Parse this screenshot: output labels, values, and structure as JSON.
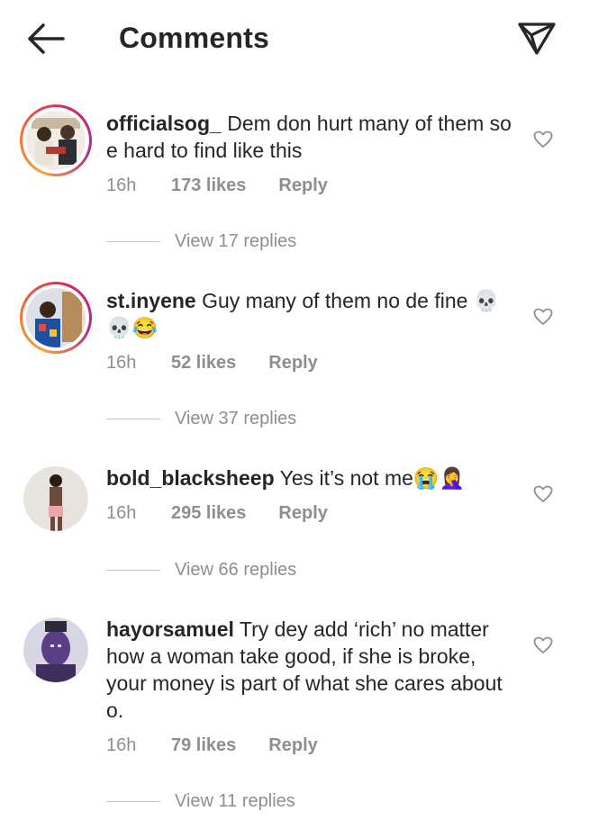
{
  "header": {
    "title": "Comments"
  },
  "comments": [
    {
      "username": "officialsog_",
      "text": " Dem don hurt many of them so e hard to find like this",
      "time": "16h",
      "likes": "173 likes",
      "reply": "Reply",
      "view_replies": "View 17 replies"
    },
    {
      "username": "st.inyene",
      "text": " Guy many of them no de fine 💀💀😂",
      "time": "16h",
      "likes": "52 likes",
      "reply": "Reply",
      "view_replies": "View 37 replies"
    },
    {
      "username": "bold_blacksheep",
      "text": " Yes it’s not me😭🤦‍♀️",
      "time": "16h",
      "likes": "295 likes",
      "reply": "Reply",
      "view_replies": "View 66 replies"
    },
    {
      "username": "hayorsamuel",
      "text": " Try dey add ‘rich’ no matter how a woman take good, if she is broke, your money is part of what she cares about o.",
      "time": "16h",
      "likes": "79 likes",
      "reply": "Reply",
      "view_replies": "View 11 replies"
    }
  ],
  "colors": {
    "text": "#262626",
    "muted": "#8e8e8e",
    "story_ring": "#d8255a"
  },
  "icons": [
    "back-arrow-icon",
    "send-icon",
    "heart-icon"
  ]
}
